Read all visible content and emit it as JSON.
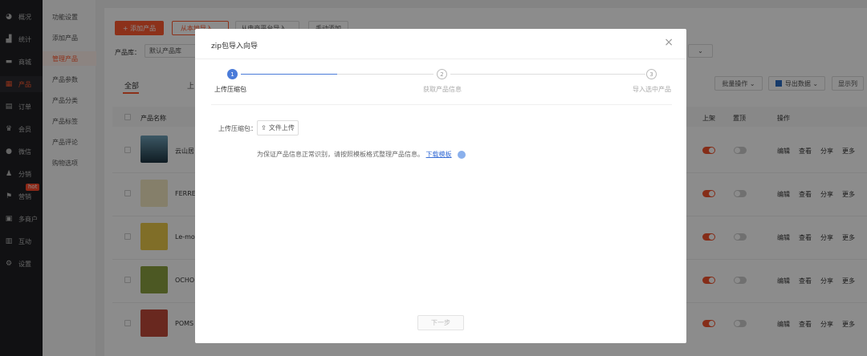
{
  "nav": {
    "items": [
      {
        "label": "概况",
        "icon": "dashboard-icon",
        "glyph": "◕"
      },
      {
        "label": "统计",
        "icon": "chart-icon",
        "glyph": "▟"
      },
      {
        "label": "商城",
        "icon": "store-icon",
        "glyph": "▬"
      },
      {
        "label": "产品",
        "icon": "grid-icon",
        "glyph": "▦"
      },
      {
        "label": "订单",
        "icon": "order-icon",
        "glyph": "▤"
      },
      {
        "label": "会员",
        "icon": "crown-icon",
        "glyph": "♛"
      },
      {
        "label": "微信",
        "icon": "wechat-icon",
        "glyph": "●"
      },
      {
        "label": "分销",
        "icon": "distribution-icon",
        "glyph": "♟"
      },
      {
        "label": "营销",
        "icon": "flag-icon",
        "glyph": "⚑"
      },
      {
        "label": "多商户",
        "icon": "merchant-icon",
        "glyph": "▣"
      },
      {
        "label": "互动",
        "icon": "interact-icon",
        "glyph": "▥"
      },
      {
        "label": "设置",
        "icon": "settings-icon",
        "glyph": "⚙"
      }
    ],
    "hot_badge": "hot"
  },
  "submenu": {
    "items": [
      "功能设置",
      "添加产品",
      "管理产品",
      "产品参数",
      "产品分类",
      "产品标签",
      "产品评论",
      "购物选项"
    ]
  },
  "toolbar": {
    "add_product": "+ 添加产品",
    "import_local": "从本地导入",
    "import_platform": "从电商平台导入",
    "manual_add": "手动添加",
    "library_label": "产品库：",
    "library_value": "默认产品库"
  },
  "tabs": {
    "all": "全部",
    "up": "上"
  },
  "actions": {
    "batch": "批量操作",
    "export": "导出数据",
    "columns": "显示列"
  },
  "table": {
    "header_name": "产品名称",
    "header_up": "上架",
    "header_top": "置顶",
    "header_ops": "操作",
    "row_ops": [
      "编辑",
      "查看",
      "分享",
      "更多"
    ],
    "rows": [
      {
        "name": "云山居"
      },
      {
        "name": "FERRER"
      },
      {
        "name": "Le-mor"
      },
      {
        "name": "OCHO"
      },
      {
        "name": "POMS"
      }
    ]
  },
  "modal": {
    "title": "zip包导入向导",
    "steps": [
      {
        "num": "1",
        "label": "上传压缩包"
      },
      {
        "num": "2",
        "label": "获取产品信息"
      },
      {
        "num": "3",
        "label": "导入选中产品"
      }
    ],
    "upload_label": "上传压缩包：",
    "upload_button": "文件上传",
    "hint": "为保证产品信息正常识别，请按照模板格式整理产品信息。",
    "template_link": "下载模板",
    "next_button": "下一步",
    "accent": "#4a7bd9"
  }
}
